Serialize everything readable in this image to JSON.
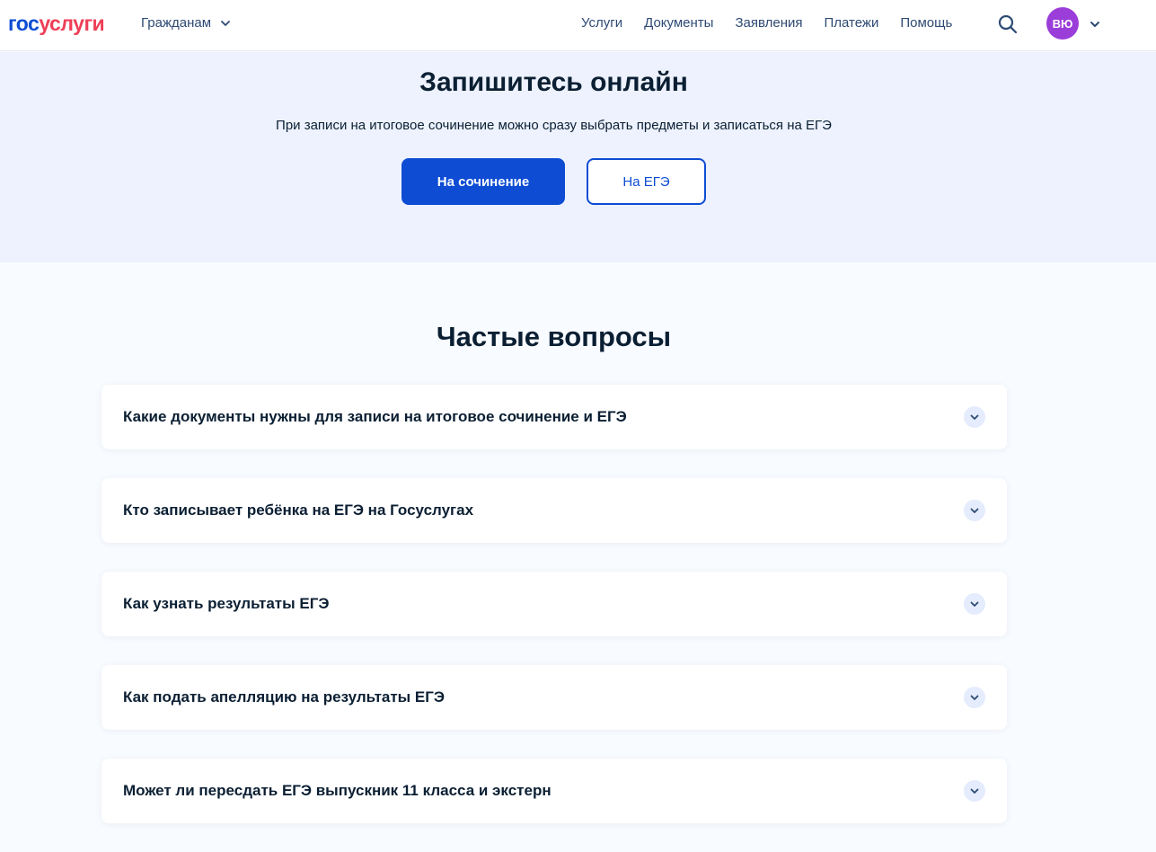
{
  "header": {
    "logo_part_a": "гос",
    "logo_part_b": "услуги",
    "citizen_menu_label": "Гражданам",
    "nav": [
      {
        "label": "Услуги"
      },
      {
        "label": "Документы"
      },
      {
        "label": "Заявления"
      },
      {
        "label": "Платежи"
      },
      {
        "label": "Помощь"
      }
    ],
    "search_icon": "search-icon",
    "avatar_initials": "ВЮ",
    "avatar_color": "#9b3dd9"
  },
  "promo": {
    "title": "Запишитесь онлайн",
    "subtitle": "При записи на итоговое сочинение можно сразу выбрать предметы и записаться на ЕГЭ",
    "primary_button": "На сочинение",
    "secondary_button": "На ЕГЭ"
  },
  "faq": {
    "title": "Частые вопросы",
    "items": [
      {
        "question": "Какие документы нужны для записи на итоговое сочинение и ЕГЭ"
      },
      {
        "question": "Кто записывает ребёнка на ЕГЭ на Госуслугах"
      },
      {
        "question": "Как узнать результаты ЕГЭ"
      },
      {
        "question": "Как подать апелляцию на результаты ЕГЭ"
      },
      {
        "question": "Может ли пересдать ЕГЭ выпускник 11 класса и экстерн"
      }
    ],
    "toggle_icon": "chevron-down-icon"
  },
  "colors": {
    "brand_blue": "#0d4cd3",
    "brand_red": "#ee3f58",
    "promo_bg": "#edf2fe",
    "page_bg": "#f8fbff",
    "text_dark": "#0b1f33",
    "nav_text": "#2e4a74"
  }
}
